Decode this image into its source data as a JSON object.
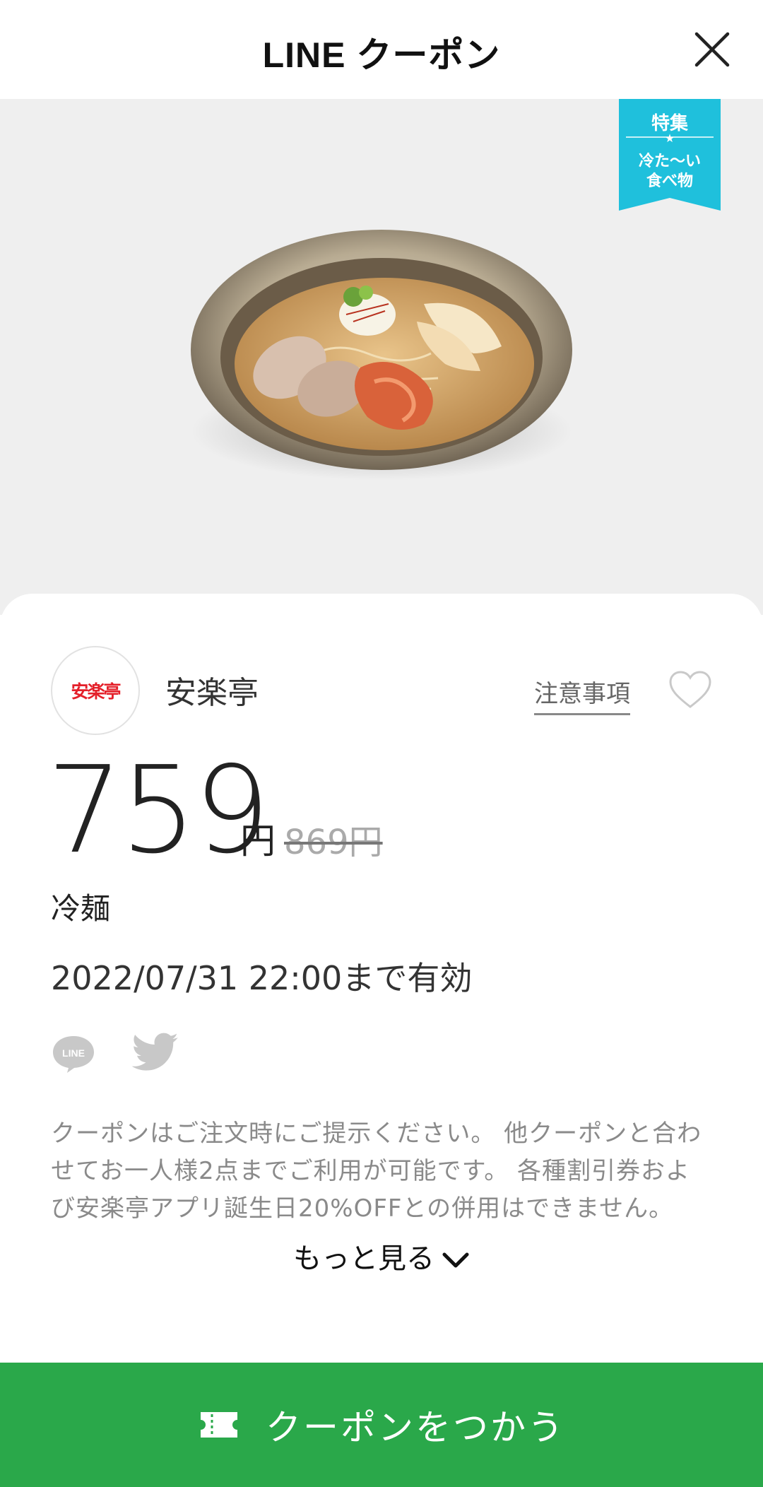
{
  "header": {
    "title": "LINE クーポン",
    "close_icon": "close-icon"
  },
  "hero": {
    "ribbon_top": "特集",
    "ribbon_line1": "冷た〜い",
    "ribbon_line2": "食べ物",
    "ribbon_color": "#1fc0dc"
  },
  "shop": {
    "logo_text": "安楽亭",
    "name": "安楽亭",
    "notice_label": "注意事項"
  },
  "coupon": {
    "price": "759",
    "unit": "円",
    "original_price": "869円",
    "item_name": "冷麺",
    "validity": "2022/07/31 22:00まで有効"
  },
  "share": {
    "line_label": "LINE",
    "twitter_icon": "twitter-icon"
  },
  "description": "クーポンはご注文時にご提示ください。 他クーポンと合わせてお一人様2点までご利用が可能です。 各種割引券および安楽亭アプリ誕生日20%OFFとの併用はできません。",
  "more_label": "もっと見る",
  "use_button": {
    "label": "クーポンをつかう",
    "color": "#2aa84a"
  }
}
